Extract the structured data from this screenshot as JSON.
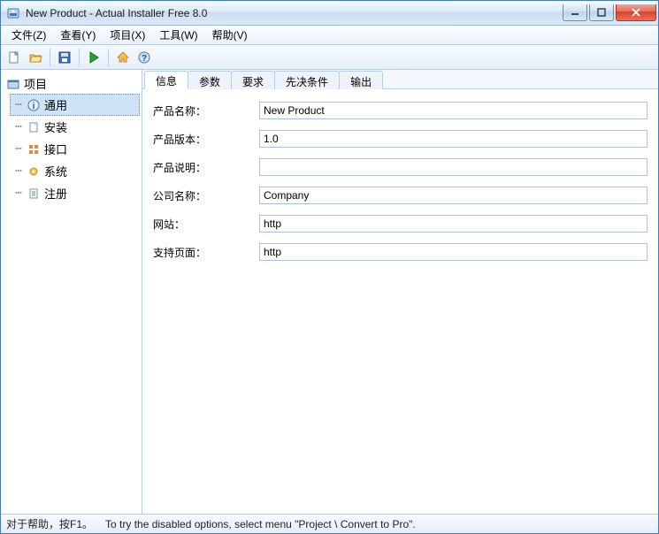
{
  "window": {
    "title": "New Product - Actual Installer Free 8.0"
  },
  "menu": {
    "items": [
      "文件(Z)",
      "查看(Y)",
      "项目(X)",
      "工具(W)",
      "帮助(V)"
    ]
  },
  "toolbar": {
    "icons": [
      "new-file-icon",
      "open-folder-icon",
      "save-icon",
      "run-icon",
      "home-icon",
      "help-icon"
    ]
  },
  "sidebar": {
    "root_label": "项目",
    "items": [
      {
        "id": "general",
        "label": "通用",
        "icon": "info-icon",
        "selected": true
      },
      {
        "id": "install",
        "label": "安装",
        "icon": "page-icon",
        "selected": false
      },
      {
        "id": "interface",
        "label": "接口",
        "icon": "grid-icon",
        "selected": false
      },
      {
        "id": "system",
        "label": "系统",
        "icon": "gear-icon",
        "selected": false
      },
      {
        "id": "register",
        "label": "注册",
        "icon": "note-icon",
        "selected": false
      }
    ]
  },
  "tabs": {
    "items": [
      "信息",
      "参数",
      "要求",
      "先决条件",
      "输出"
    ],
    "active_index": 0
  },
  "form": {
    "rows": [
      {
        "label": "产品名称：",
        "value": "New Product"
      },
      {
        "label": "产品版本：",
        "value": "1.0"
      },
      {
        "label": "产品说明：",
        "value": ""
      },
      {
        "label": "公司名称：",
        "value": "Company"
      },
      {
        "label": "网站：",
        "value": "http"
      },
      {
        "label": "支持页面：",
        "value": "http"
      }
    ]
  },
  "statusbar": {
    "left": "对于帮助，按F1。",
    "right": "To try the disabled options, select menu \"Project \\ Convert to Pro\"."
  }
}
